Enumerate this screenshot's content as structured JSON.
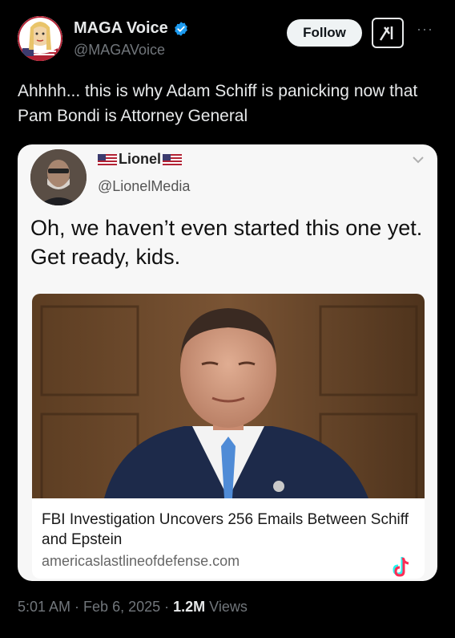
{
  "author": {
    "display_name": "MAGA Voice",
    "handle": "@MAGAVoice",
    "verified_icon": "verified-badge-icon",
    "avatar_icon": "avatar"
  },
  "actions": {
    "follow_label": "Follow",
    "grok_icon": "grok-icon",
    "more_icon": "more-icon",
    "more_glyph": "···"
  },
  "tweet": {
    "text": "Ahhhh... this is why Adam Schiff is panicking now that Pam Bondi is Attorney General"
  },
  "embedded": {
    "name": "Lionel",
    "handle": "@LionelMedia",
    "text": "Oh, we haven’t even started this one yet. Get ready, kids.",
    "headline": "FBI Investigation Uncovers 256 Emails Between Schiff and Epstein",
    "source": "americaslastlineofdefense.com",
    "watermark_icon": "tiktok-icon"
  },
  "meta": {
    "time": "5:01 AM",
    "sep1": "·",
    "date": "Feb 6, 2025",
    "sep2": "·",
    "views_count": "1.2M",
    "views_label": "Views"
  },
  "colors": {
    "background": "#000000",
    "text_primary": "#e7e9ea",
    "text_secondary": "#71767b",
    "verified": "#1d9bf0"
  }
}
